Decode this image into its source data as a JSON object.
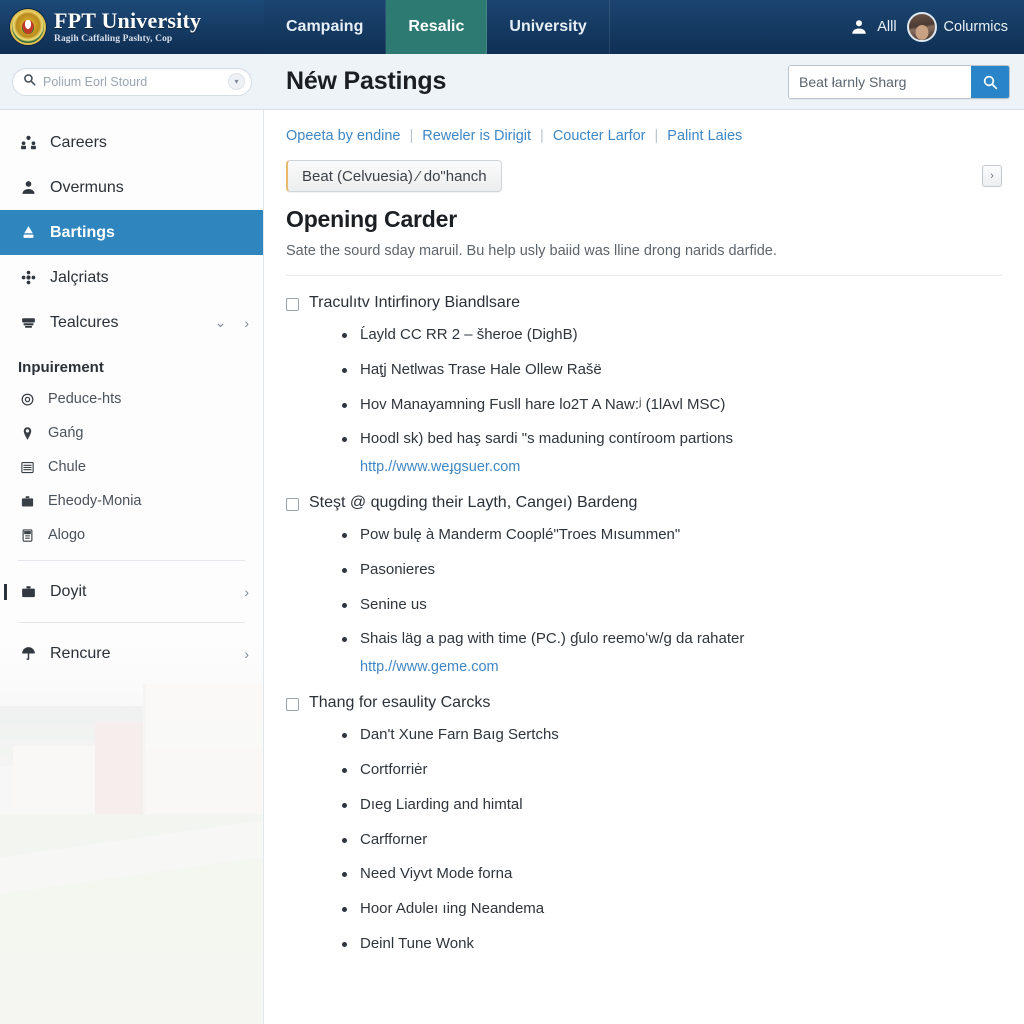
{
  "topbar": {
    "brand": {
      "seal_icon": "university-seal-icon",
      "title": "FPT University",
      "subtitle": "Ragih Caffaling Pashty, Cop"
    },
    "nav": [
      {
        "label": "Campaing",
        "active": false
      },
      {
        "label": "Resalic",
        "active": true
      },
      {
        "label": "University",
        "active": false
      }
    ],
    "user": {
      "person_icon": "person-icon",
      "name": "Alll",
      "avatar_icon": "avatar",
      "account": "Colurmics"
    },
    "colors": {
      "bar": "#123a5e",
      "active_tab": "#2d7a73"
    }
  },
  "subheader": {
    "sidebar_search": {
      "icon": "search-icon",
      "placeholder": "Polium Eorl Stourd",
      "mini_icon": "chevron-down-icon"
    },
    "page_title": "Néw Pastings",
    "search": {
      "value": "Beat łarnly Sharg",
      "placeholder": "Beat łarnly Sharg",
      "button_icon": "search-icon",
      "button_color": "#2a84c8"
    }
  },
  "sidebar": {
    "items": [
      {
        "label": "Careers",
        "icon": "people-group-icon",
        "active": false
      },
      {
        "label": "Overmuns",
        "icon": "person-icon",
        "active": false
      },
      {
        "label": "Bartings",
        "icon": "pin-marker-icon",
        "active": true
      },
      {
        "label": "Jalçriats",
        "icon": "cluster-dots-icon",
        "active": false
      },
      {
        "label": "Tealcures",
        "icon": "cards-stack-icon",
        "active": false,
        "chevrons": [
          "⌄",
          "›"
        ]
      }
    ],
    "section_label": "Inpuirement",
    "sub_items": [
      {
        "label": "Peduce-hts",
        "icon": "target-circle-icon"
      },
      {
        "label": "Gańg",
        "icon": "map-pin-icon"
      },
      {
        "label": "Chule",
        "icon": "list-rows-icon"
      },
      {
        "label": "Eheody-Monia",
        "icon": "briefcase-icon"
      },
      {
        "label": "Alogo",
        "icon": "calculator-icon"
      }
    ],
    "footer_items": [
      {
        "label": "Doyit",
        "icon": "toolbox-icon",
        "chevron": "›"
      },
      {
        "label": "Rencure",
        "icon": "umbrella-icon",
        "chevron": "›"
      }
    ],
    "background_image": "campus-photo"
  },
  "main": {
    "breadcrumbs": [
      "Opeeta by endine",
      "Reweler is Dirigit",
      "Coucter Larfor",
      "Palint Laies"
    ],
    "breadcrumb_separator": "|",
    "filter_button": "Beat (Celvuesia) ⁄ do\"hanch",
    "expand_button_icon": "expand-arrow-icon",
    "expand_button_glyph": "›",
    "section_title": "Opening Carder",
    "section_description": "Sate the sourd sday maruil. Bu help usly baiid was lline drong narids darfide.",
    "groups": [
      {
        "checkbox_label": "Traculıtv Intirfinory Biandlsare",
        "checked": false,
        "bullets": [
          {
            "text": "Ĺayld CC RR 2 – šheroe (DighB)"
          },
          {
            "text": "Haţj Netlwas Trase Hale Ollew Rašë"
          },
          {
            "text": "Hov Manayamning Fusll hare lo2T A Naw:ʲ (1lAvl MSC)"
          },
          {
            "text": "Hoodl sk) bed haş sardi \"s maduning contíroom partions",
            "link": "http.//www.weɟgsuer.com"
          }
        ]
      },
      {
        "checkbox_label": "Steşt @ ɋugding their Layth, Cangeı) Bardeng",
        "checked": false,
        "bullets": [
          {
            "text": "Pow bulę à Manderm Cooplé\"Troes Mısummen\""
          },
          {
            "text": "Pasonieres"
          },
          {
            "text": "Senine us"
          },
          {
            "text": "Shais läg a pag with time (PC.) ɠulo reemoʻw/g da rahater",
            "link": "http.//www.geme.com"
          }
        ]
      },
      {
        "checkbox_label": "Thang for esaulity Carcks",
        "checked": false,
        "bullets": [
          {
            "text": "Dan't Xune Farn Baıg Sertchs"
          },
          {
            "text": "Cortforriėr"
          },
          {
            "text": "Dıeg Liarding and himtal"
          },
          {
            "text": "Carfforner"
          },
          {
            "text": "Need Viyvt Mode forna"
          },
          {
            "text": "Hoor Adʋleı ıing Neandema"
          },
          {
            "text": "Deinl Tune Wonk"
          }
        ]
      }
    ]
  }
}
